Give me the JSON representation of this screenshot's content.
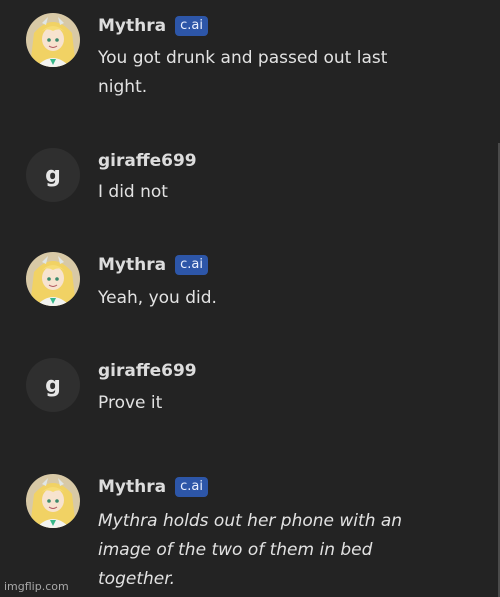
{
  "messages": [
    {
      "author": "Mythra",
      "badge": "c.ai",
      "text": "You got drunk and passed out last night."
    },
    {
      "author": "giraffe699",
      "avatar_letter": "g",
      "text": "I did not"
    },
    {
      "author": "Mythra",
      "badge": "c.ai",
      "text": "Yeah, you did."
    },
    {
      "author": "giraffe699",
      "avatar_letter": "g",
      "text": "Prove it"
    },
    {
      "author": "Mythra",
      "badge": "c.ai",
      "text": "Mythra holds out her phone with an image of the two of them in bed together."
    }
  ],
  "watermark": "imgflip.com",
  "colors": {
    "background": "#232323",
    "badge": "#2d56a8",
    "user_avatar": "#2f2f2f"
  }
}
